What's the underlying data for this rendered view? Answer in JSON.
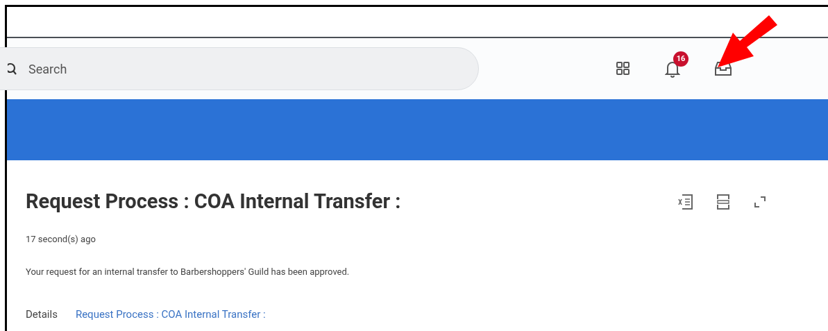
{
  "search": {
    "placeholder": "Search"
  },
  "notifications": {
    "badge": "16"
  },
  "notification": {
    "title": "Request Process : COA Internal Transfer :",
    "time": "17 second(s) ago",
    "message": "Your request for an internal transfer to Barbershoppers' Guild has been approved.",
    "details_label": "Details",
    "details_link": "Request Process : COA Internal Transfer :"
  }
}
